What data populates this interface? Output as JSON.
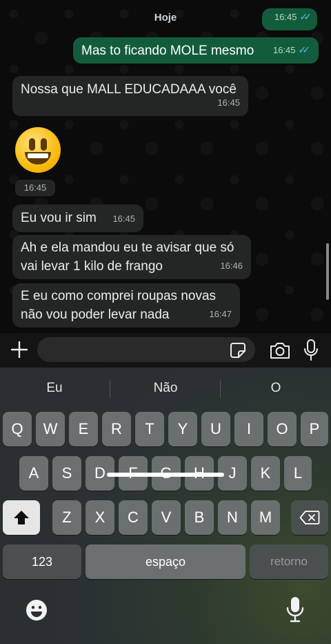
{
  "chat": {
    "date_label": "Hoje",
    "messages": [
      {
        "text": "",
        "time": "16:45",
        "dir": "out"
      },
      {
        "text": "Mas to ficando MOLE mesmo",
        "time": "16:45",
        "dir": "out"
      },
      {
        "text": "Nossa que MALL EDUCADAAA você",
        "time": "16:45",
        "dir": "in"
      },
      {
        "text": "😃",
        "time": "16:45",
        "dir": "in"
      },
      {
        "text": "Eu vou ir sim",
        "time": "16:45",
        "dir": "in"
      },
      {
        "text_line1": "Ah e ela mandou eu te avisar que só",
        "text_line2": "vai levar 1 kilo de frango",
        "time": "16:46",
        "dir": "in"
      },
      {
        "text_line1": "E eu como comprei roupas novas",
        "text_line2": "não vou poder levar nada",
        "time": "16:47",
        "dir": "in"
      }
    ]
  },
  "input_bar": {
    "placeholder": "",
    "icons": [
      "plus-icon",
      "sticker-icon",
      "camera-icon",
      "mic-icon"
    ]
  },
  "keyboard": {
    "suggestions": [
      "Eu",
      "Não",
      "O"
    ],
    "row1": [
      "Q",
      "W",
      "E",
      "R",
      "T",
      "Y",
      "U",
      "I",
      "O",
      "P"
    ],
    "row2": [
      "A",
      "S",
      "D",
      "F",
      "G",
      "H",
      "J",
      "K",
      "L"
    ],
    "row3": [
      "Z",
      "X",
      "C",
      "V",
      "B",
      "N",
      "M"
    ],
    "numbers_label": "123",
    "space_label": "espaço",
    "return_label": "retorno",
    "icons": [
      "shift-icon",
      "backspace-icon",
      "emoji-icon",
      "dictation-icon"
    ]
  },
  "colors": {
    "outgoing_bubble": "#125c3c",
    "incoming_bubble": "#242626",
    "read_tick": "#53bdeb"
  }
}
